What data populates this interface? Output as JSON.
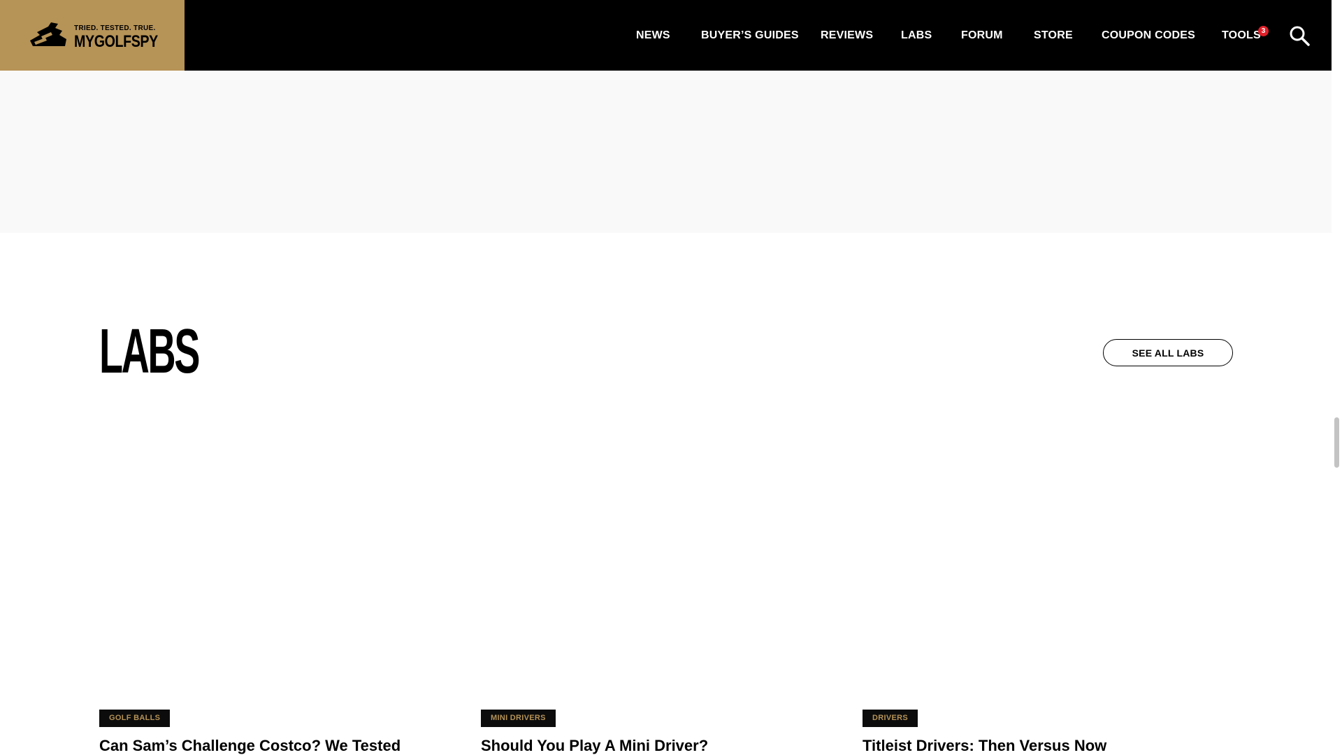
{
  "header": {
    "logo": {
      "tagline": "TRIED. TESTED. TRUE.",
      "name": "MYGOLFSPY"
    },
    "nav": [
      {
        "label": "NEWS"
      },
      {
        "label": "BUYER’S GUIDES"
      },
      {
        "label": "REVIEWS"
      },
      {
        "label": "LABS"
      },
      {
        "label": "FORUM"
      },
      {
        "label": "STORE"
      },
      {
        "label": "COUPON CODES"
      },
      {
        "label": "TOOLS"
      }
    ],
    "tools_badge": "3",
    "search_icon": "search-icon"
  },
  "labs": {
    "title": "LABS",
    "see_all_label": "SEE ALL LABS",
    "cards": [
      {
        "tag": "GOLF BALLS",
        "title": "Can Sam’s Challenge Costco? We Tested Member’s"
      },
      {
        "tag": "MINI DRIVERS",
        "title": "Should You Play A Mini Driver?"
      },
      {
        "tag": "DRIVERS",
        "title": "Titleist Drivers: Then Versus Now"
      }
    ]
  },
  "colors": {
    "brand_gold": "#b69357",
    "header_bg": "#000000",
    "badge_red": "#e0202a"
  }
}
